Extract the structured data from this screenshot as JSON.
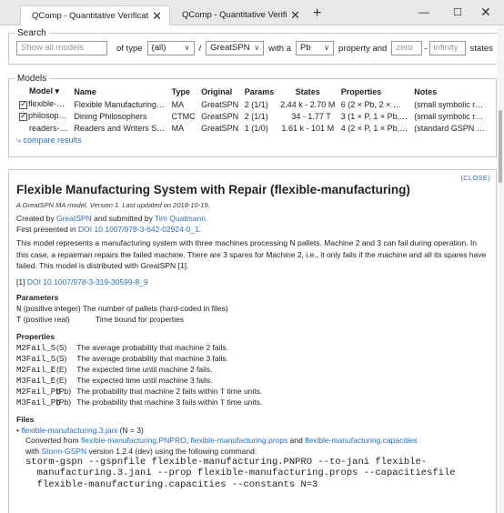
{
  "tabs": [
    {
      "title": "QComp - Quantitative Verification Benchmark Set",
      "close": "✕"
    },
    {
      "title": "QComp - Quantitative Verification Benchmark Set",
      "close": "✕"
    }
  ],
  "newtab": "+",
  "window": {
    "minimize": "—",
    "maximize": "☐",
    "close": "✕"
  },
  "search": {
    "legend": "Search",
    "input_placeholder": "Show all models",
    "of_type": "of type",
    "type_value": "(all)",
    "slash": "/",
    "formalism_value": "GreatSPN",
    "with_a": "with a",
    "property_value": "Pb",
    "property_and": "property and",
    "min_placeholder": "zero",
    "dash": "-",
    "max_placeholder": "infinity",
    "states": "states"
  },
  "models": {
    "legend": "Models",
    "headers": [
      "Model ▾",
      "Name",
      "Type",
      "Original",
      "Params",
      "States",
      "Properties",
      "Notes"
    ],
    "rows": [
      {
        "checked": true,
        "cells": [
          "flexible-…",
          "Flexible Manufacturing…",
          "MA",
          "GreatSPN",
          "2 (1/1)",
          "2.44 k - 2.70 M",
          "6 (2 × Pb, 2 × …",
          "(small symbolic r…"
        ]
      },
      {
        "checked": true,
        "cells": [
          "philosop…",
          "Dining Philosophers",
          "CTMC",
          "GreatSPN",
          "2 (1/1)",
          "34 - 1.77 T",
          "3 (1 × P, 1 × Pb,…",
          "(small symbolic r…"
        ]
      },
      {
        "checked": false,
        "cells": [
          "readers-…",
          "Readers and Writers S…",
          "MA",
          "GreatSPN",
          "1 (1/0)",
          "1.61 k - 101 M",
          "4 (2 × P, 1 × Pb,…",
          "(standard GSPN …"
        ]
      }
    ],
    "compare": "⤷ compare results"
  },
  "detail": {
    "close": "(CLOSE)",
    "title": "Flexible Manufacturing System with Repair (flexible-manufacturing)",
    "meta": "A GreatSPN MA model. Version 1. Last updated on 2018-10-19.",
    "created_prefix": "Created by",
    "created_by": "GreatSPN",
    "submitted_prefix": "and submitted by",
    "submitted_by": "Tim Quatmann.",
    "presented_prefix": "First presented in",
    "presented_doi": "DOI 10.1007/978-3-642-02924-0_1",
    "presented_suffix": ".",
    "description": "This model represents a manufacturing system with three machines processing N pallets. Machine 2 and 3 can fail during operation. In this case, a repairman repairs the failed machine. There are 3 spares for Machine 2, i.e., it only fails if the machine and all its spares have failed. This model is distributed with GreatSPN [1].",
    "ref_prefix": "[1]",
    "ref_doi": "DOI 10.1007/978-3-319-30599-8_9",
    "parameters_heading": "Parameters",
    "parameters": [
      {
        "name": "N",
        "type": "(positive integer)",
        "desc": "The number of pallets (hard-coded in files)"
      },
      {
        "name": "T",
        "type": "(positive real)",
        "desc": "Time bound for properties"
      }
    ],
    "properties_heading": "Properties",
    "properties": [
      {
        "code": "M2Fail_S",
        "type": "(S)",
        "desc": "The average probability that machine 2 fails."
      },
      {
        "code": "M3Fail_S",
        "type": "(S)",
        "desc": "The average probability that machine 3 fails."
      },
      {
        "code": "M2Fail_E",
        "type": "(E)",
        "desc": "The expected time until machine 2 fails."
      },
      {
        "code": "M3Fail_E",
        "type": "(E)",
        "desc": "The expected time until machine 3 fails."
      },
      {
        "code": "M2Fail_Pb",
        "type": "(Pb)",
        "desc_pre": "The probability that machine 2 fails within",
        "desc_var": "T",
        "desc_post": "time units."
      },
      {
        "code": "M3Fail_Pb",
        "type": "(Pb)",
        "desc_pre": "The probability that machine 3 fails within",
        "desc_var": "T",
        "desc_post": "time units."
      }
    ],
    "files_heading": "Files",
    "file": {
      "name": "flexible-manufacturing.3.jani",
      "const": "(N = 3)",
      "conv_pre": "Converted from",
      "src1": "flexible-manufacturing.PNPRO",
      "comma": ",",
      "src2": "flexible-manufacturing.props",
      "and": "and",
      "src3": "flexible-manufacturing.capacities",
      "with_pre": "with",
      "tool": "Storm-GSPN",
      "with_post": "version 1.2.4 (dev) using the following command:",
      "command": "storm-gspn --gspnfile flexible-manufacturing.PNPRO --to-jani flexible-\n  manufacturing.3.jani --prop flexible-manufacturing.props --capacitiesfile\n  flexible-manufacturing.capacities --constants N=3"
    }
  }
}
